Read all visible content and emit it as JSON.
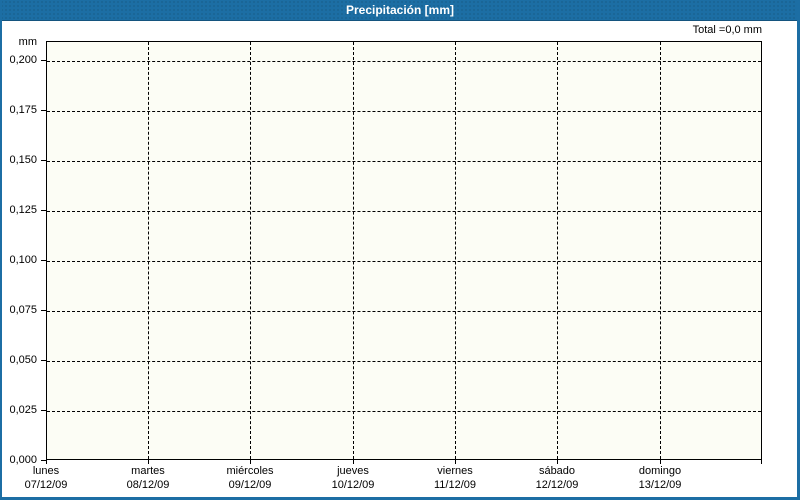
{
  "header": {
    "title": "Precipitación [mm]"
  },
  "summary": {
    "total_label": "Total =0,0 mm"
  },
  "colors": {
    "window_border": "#1c6ea4",
    "titlebar_bg": "#1c6ea4",
    "titlebar_text": "#ffffff",
    "plot_bg": "#fcfdf5",
    "grid": "#000000",
    "text": "#000000"
  },
  "chart_data": {
    "type": "bar",
    "title": "Precipitación [mm]",
    "ylabel": "mm",
    "y_axis_unit": "mm",
    "ylim": [
      0.0,
      0.2
    ],
    "y_tick_step": 0.025,
    "y_tick_labels": [
      "0,200",
      "0,175",
      "0,150",
      "0,125",
      "0,100",
      "0,075",
      "0,050",
      "0,025",
      "0,000"
    ],
    "grid": "dashed, horizontal and vertical",
    "legend": "none",
    "total": "0,0 mm",
    "categories": [
      "07/12/09",
      "08/12/09",
      "09/12/09",
      "10/12/09",
      "11/12/09",
      "12/12/09",
      "13/12/09"
    ],
    "x_labels": [
      {
        "day": "lunes",
        "date": "07/12/09"
      },
      {
        "day": "martes",
        "date": "08/12/09"
      },
      {
        "day": "miércoles",
        "date": "09/12/09"
      },
      {
        "day": "jueves",
        "date": "10/12/09"
      },
      {
        "day": "viernes",
        "date": "11/12/09"
      },
      {
        "day": "sábado",
        "date": "12/12/09"
      },
      {
        "day": "domingo",
        "date": "13/12/09"
      }
    ],
    "series": [
      {
        "name": "Precipitación",
        "values": [
          0,
          0,
          0,
          0,
          0,
          0,
          0
        ]
      }
    ]
  }
}
